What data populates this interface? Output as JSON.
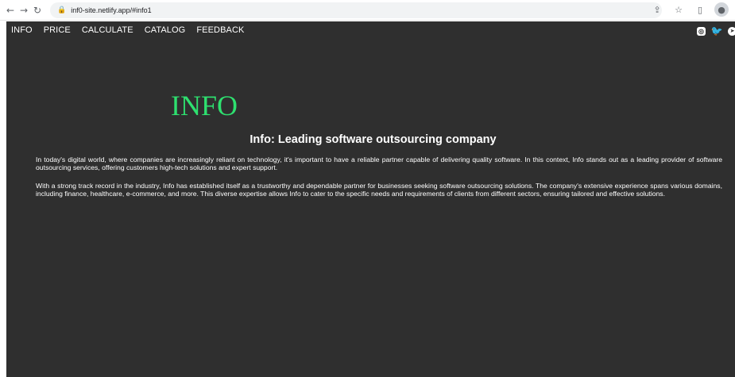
{
  "browser": {
    "url": "inf0-site.netlify.app/#info1",
    "icons": [
      "back-arrow-icon",
      "forward-arrow-icon",
      "reload-icon",
      "lock-icon",
      "share-icon",
      "star-icon",
      "sidebar-icon",
      "profile-icon"
    ]
  },
  "nav": {
    "items": [
      "INFO",
      "PRICE",
      "CALCULATE",
      "CATALOG",
      "FEEDBACK"
    ]
  },
  "social": [
    "instagram-icon",
    "twitter-icon",
    "telegram-icon"
  ],
  "main": {
    "title": "INFO",
    "subtitle": "Info: Leading software outsourcing company",
    "paragraphs": [
      "In today's digital world, where companies are increasingly reliant on technology, it's important to have a reliable partner capable of delivering quality software. In this context, Info stands out as a leading provider of software outsourcing services, offering customers high-tech solutions and expert support.",
      "With a strong track record in the industry, Info has established itself as a trustworthy and dependable partner for businesses seeking software outsourcing solutions. The company's extensive experience spans various domains, including finance, healthcare, e-commerce, and more. This diverse expertise allows Info to cater to the specific needs and requirements of clients from different sectors, ensuring tailored and effective solutions."
    ]
  },
  "colors": {
    "background": "#2f2f2f",
    "title": "#2ee06f",
    "text": "#ffffff"
  }
}
